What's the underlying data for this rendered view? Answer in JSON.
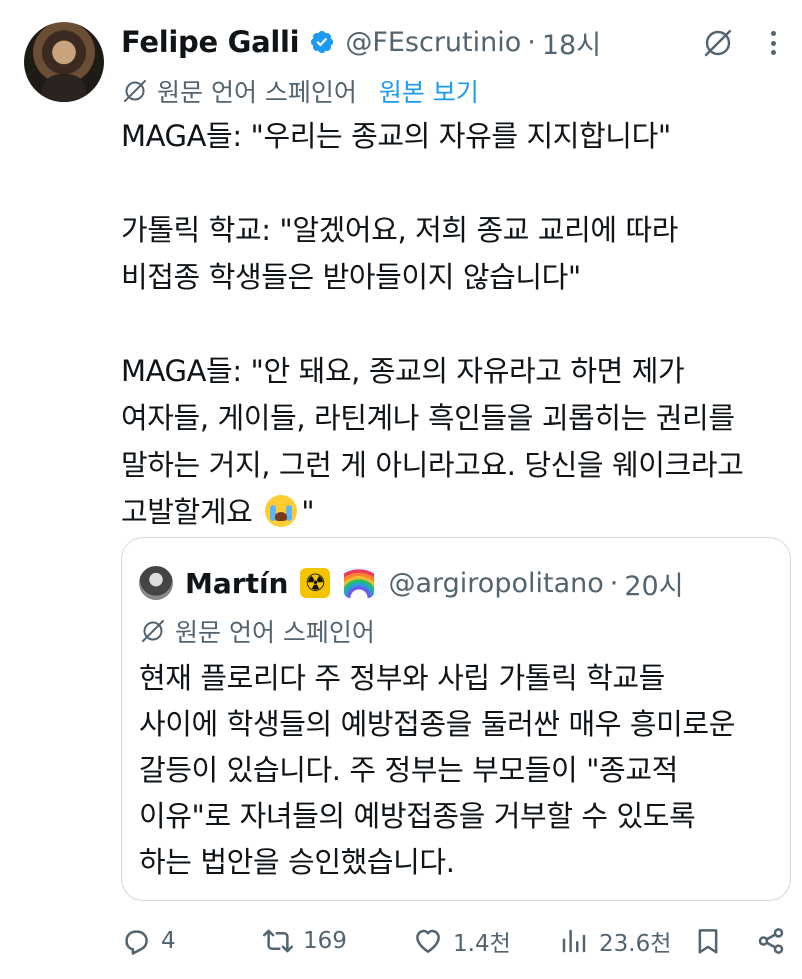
{
  "tweet": {
    "author_name": "Felipe Galli",
    "handle": "@FEscrutinio",
    "separator": "·",
    "time": "18시",
    "translate_label": "원문 언어 스페인어",
    "show_original": "원본 보기",
    "lines": [
      "MAGA들: \"우리는 종교의 자유를 지지합니다\"",
      "가톨릭 학교: \"알겠어요, 저희 종교 교리에 따라",
      "비접종 학생들은 받아들이지 않습니다\"",
      "MAGA들: \"안 돼요, 종교의 자유라고 하면 제가",
      "여자들, 게이들, 라틴계나 흑인들을 괴롭히는 권리를",
      "말하는 거지, 그런 게 아니라고요. 당신을 웨이크라고",
      "고발할게요",
      "\""
    ]
  },
  "quote": {
    "author_name": "Martín",
    "handle": "@argiropolitano",
    "separator": "·",
    "time": "20시",
    "translate_label": "원문 언어 스페인어",
    "lines": [
      "현재 플로리다 주 정부와 사립 가톨릭 학교들",
      "사이에 학생들의 예방접종을 둘러싼 매우 흥미로운",
      "갈등이 있습니다. 주 정부는 부모들이 \"종교적",
      "이유\"로 자녀들의 예방접종을 거부할 수 있도록",
      "하는 법안을 승인했습니다."
    ]
  },
  "actions": {
    "replies": "4",
    "reposts": "169",
    "likes": "1.4천",
    "views": "23.6천"
  },
  "colors": {
    "accent": "#1d9bf0",
    "secondary_text": "#536471",
    "border": "#cfd9de"
  }
}
